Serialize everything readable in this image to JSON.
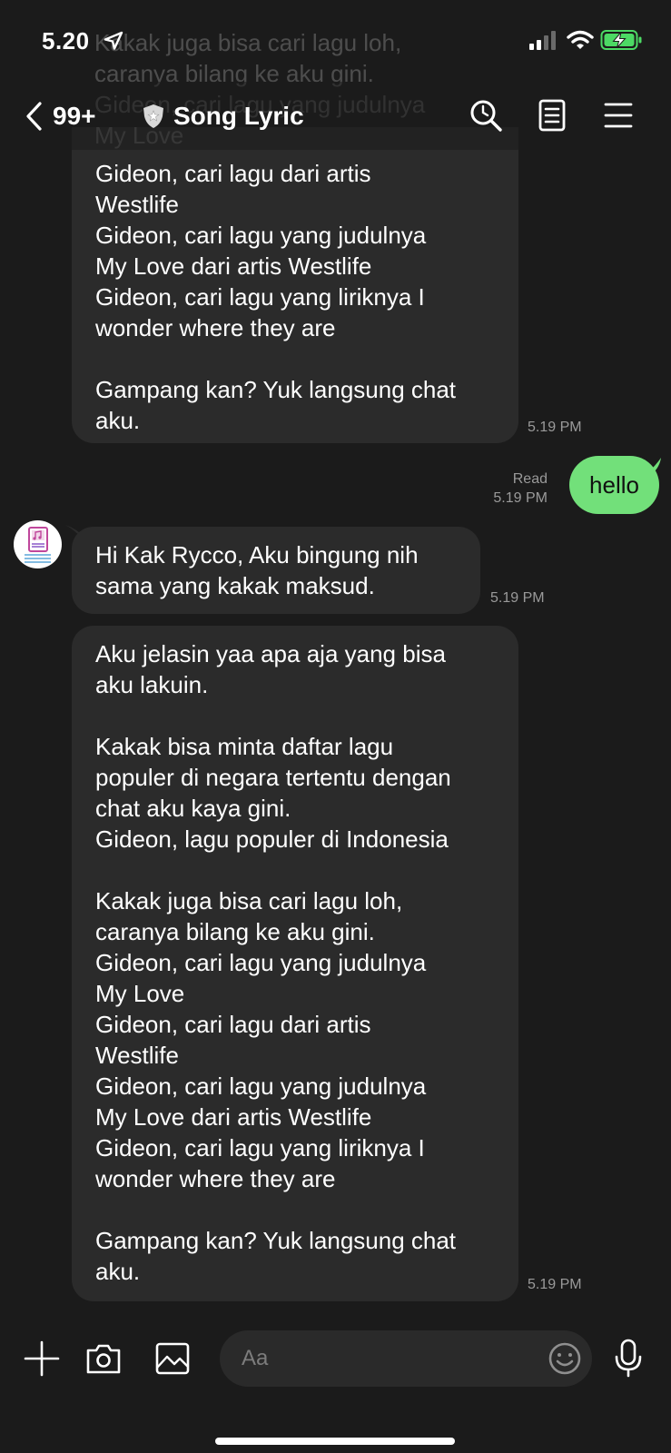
{
  "status_bar": {
    "time": "5.20"
  },
  "header": {
    "back_count": "99+",
    "title": "Song Lyric"
  },
  "ghost_text": "Kakak juga bisa cari lagu loh,\ncaranya bilang ke aku gini.\nGideon, cari lagu yang judulnya\nMy Love",
  "messages": [
    {
      "from": "bot",
      "text": "Gideon, cari lagu dari artis\nWestlife\nGideon, cari lagu yang judulnya\nMy Love dari artis Westlife\nGideon, cari lagu yang liriknya I\nwonder where they are\n\nGampang kan? Yuk langsung chat\naku.",
      "time": "5.19 PM"
    },
    {
      "from": "me",
      "text": "hello",
      "status": "Read",
      "time": "5.19 PM"
    },
    {
      "from": "bot",
      "text": "Hi Kak Rycco, Aku bingung nih\nsama yang kakak maksud.",
      "time": "5.19 PM"
    },
    {
      "from": "bot",
      "text": "Aku jelasin yaa apa aja yang bisa\naku lakuin.\n\nKakak bisa minta daftar lagu\npopuler di negara tertentu dengan\nchat aku kaya gini.\nGideon, lagu populer di Indonesia\n\nKakak juga bisa cari lagu loh,\ncaranya bilang ke aku gini.\nGideon, cari lagu yang judulnya\nMy Love\nGideon, cari lagu dari artis\nWestlife\nGideon, cari lagu yang judulnya\nMy Love dari artis Westlife\nGideon, cari lagu yang liriknya I\nwonder where they are\n\nGampang kan? Yuk langsung chat\naku.",
      "time": "5.19 PM"
    }
  ],
  "input": {
    "placeholder": "Aa"
  },
  "icons": {
    "header": [
      "search-icon",
      "notes-icon",
      "menu-icon"
    ],
    "input_bar": [
      "plus-icon",
      "camera-icon",
      "image-icon",
      "emoji-icon",
      "microphone-icon"
    ]
  },
  "colors": {
    "background": "#1b1b1b",
    "bubble_in": "#2b2b2b",
    "bubble_out": "#72e07a",
    "battery": "#4cd964"
  }
}
